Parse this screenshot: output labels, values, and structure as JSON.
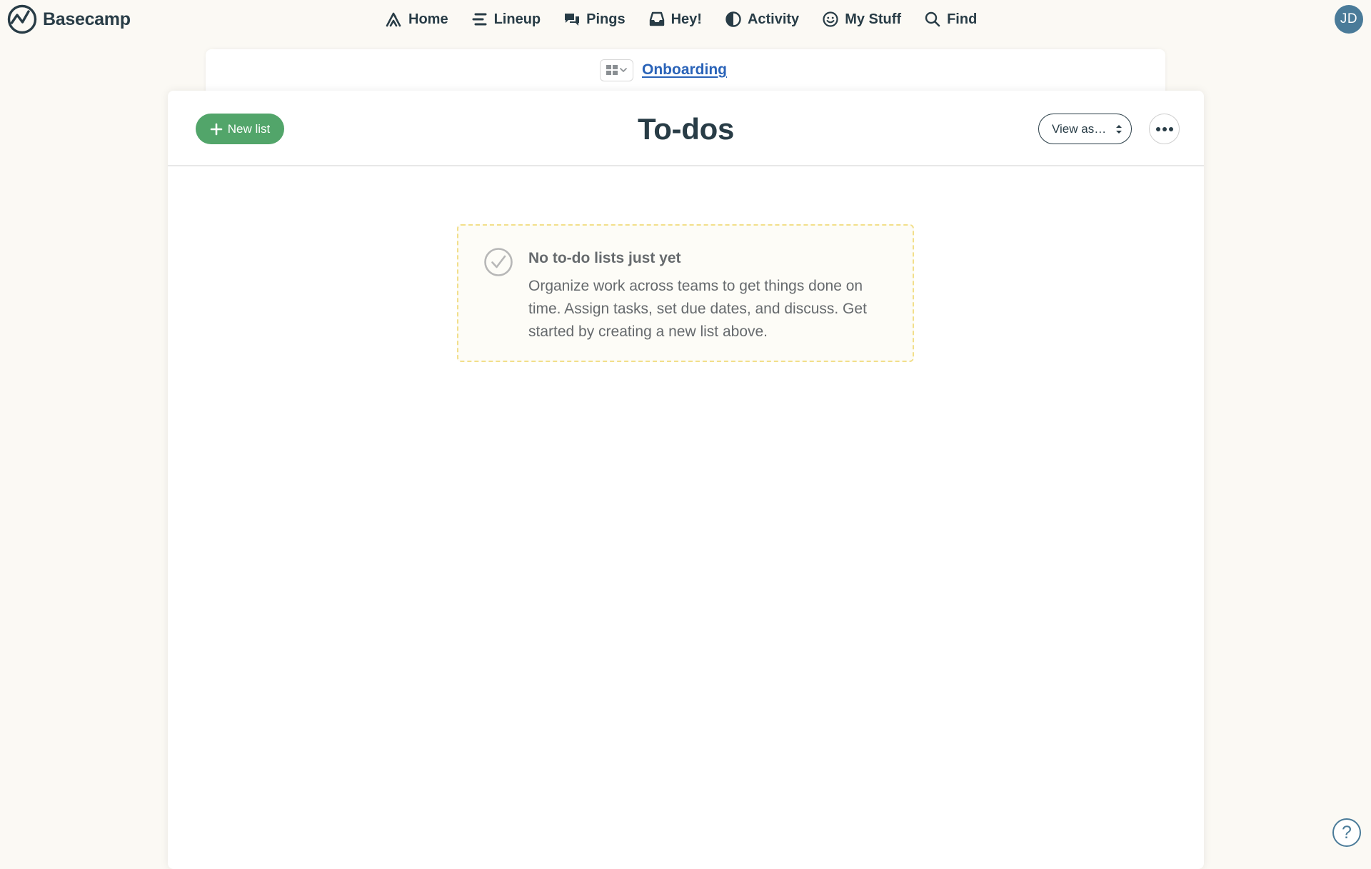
{
  "brand": {
    "name": "Basecamp"
  },
  "nav": {
    "home": "Home",
    "lineup": "Lineup",
    "pings": "Pings",
    "hey": "Hey!",
    "activity": "Activity",
    "my_stuff": "My Stuff",
    "find": "Find"
  },
  "user": {
    "initials": "JD",
    "avatar_color": "#4a7b99"
  },
  "breadcrumb": {
    "project": "Onboarding"
  },
  "toolbar": {
    "new_list_label": "New list",
    "title": "To-dos",
    "view_as_label": "View as…"
  },
  "empty_state": {
    "title": "No to-do lists just yet",
    "body": "Organize work across teams to get things done on time. Assign tasks, set due dates, and discuss. Get started by creating a new list above."
  },
  "help": {
    "label": "?"
  },
  "colors": {
    "background": "#fbf9f4",
    "text": "#283c46",
    "link": "#2a63b8",
    "primary_button": "#52a56a",
    "empty_border": "#f2df8a"
  }
}
